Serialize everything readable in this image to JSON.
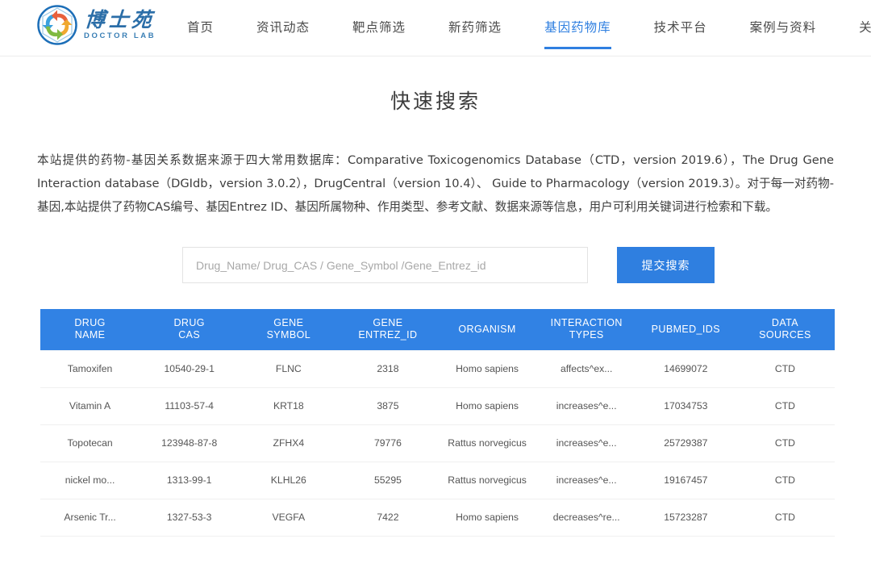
{
  "brand": {
    "logo_icon": "pinwheel-circle-logo",
    "name_cn": "博士苑",
    "name_en": "DOCTOR LAB"
  },
  "nav": {
    "items": [
      {
        "label": "首页",
        "active": false
      },
      {
        "label": "资讯动态",
        "active": false
      },
      {
        "label": "靶点筛选",
        "active": false
      },
      {
        "label": "新药筛选",
        "active": false
      },
      {
        "label": "基因药物库",
        "active": true
      },
      {
        "label": "技术平台",
        "active": false
      },
      {
        "label": "案例与资料",
        "active": false
      },
      {
        "label": "关于我们",
        "active": false
      }
    ]
  },
  "page": {
    "title": "快速搜索",
    "description": "本站提供的药物-基因关系数据来源于四大常用数据库：Comparative Toxicogenomics Database（CTD，version 2019.6），The Drug Gene Interaction database（DGIdb，version 3.0.2），DrugCentral（version 10.4）、 Guide to Pharmacology（version 2019.3）。对于每一对药物-基因,本站提供了药物CAS编号、基因Entrez ID、基因所属物种、作用类型、参考文献、数据来源等信息，用户可利用关键词进行检索和下载。"
  },
  "search": {
    "placeholder": "Drug_Name/ Drug_CAS / Gene_Symbol /Gene_Entrez_id",
    "value": "",
    "submit_label": "提交搜索"
  },
  "table": {
    "columns": [
      {
        "line1": "DRUG",
        "line2": "NAME"
      },
      {
        "line1": "DRUG",
        "line2": "CAS"
      },
      {
        "line1": "GENE",
        "line2": "SYMBOL"
      },
      {
        "line1": "GENE",
        "line2": "ENTREZ_ID"
      },
      {
        "line1": "ORGANISM",
        "line2": ""
      },
      {
        "line1": "INTERACTION",
        "line2": "TYPES"
      },
      {
        "line1": "PUBMED_IDS",
        "line2": ""
      },
      {
        "line1": "DATA",
        "line2": "SOURCES"
      }
    ],
    "rows": [
      {
        "drug_name": "Tamoxifen",
        "drug_cas": "10540-29-1",
        "gene_symbol": "FLNC",
        "gene_entrez_id": "2318",
        "organism": "Homo sapiens",
        "interaction_types": "affects^ex...",
        "pubmed_ids": "14699072",
        "data_sources": "CTD"
      },
      {
        "drug_name": "Vitamin A",
        "drug_cas": "11103-57-4",
        "gene_symbol": "KRT18",
        "gene_entrez_id": "3875",
        "organism": "Homo sapiens",
        "interaction_types": "increases^e...",
        "pubmed_ids": "17034753",
        "data_sources": "CTD"
      },
      {
        "drug_name": "Topotecan",
        "drug_cas": "123948-87-8",
        "gene_symbol": "ZFHX4",
        "gene_entrez_id": "79776",
        "organism": "Rattus norvegicus",
        "interaction_types": "increases^e...",
        "pubmed_ids": "25729387",
        "data_sources": "CTD"
      },
      {
        "drug_name": "nickel mo...",
        "drug_cas": "1313-99-1",
        "gene_symbol": "KLHL26",
        "gene_entrez_id": "55295",
        "organism": "Rattus norvegicus",
        "interaction_types": "increases^e...",
        "pubmed_ids": "19167457",
        "data_sources": "CTD"
      },
      {
        "drug_name": "Arsenic Tr...",
        "drug_cas": "1327-53-3",
        "gene_symbol": "VEGFA",
        "gene_entrez_id": "7422",
        "organism": "Homo sapiens",
        "interaction_types": "decreases^re...",
        "pubmed_ids": "15723287",
        "data_sources": "CTD"
      }
    ]
  },
  "colors": {
    "accent_blue": "#2f7fe0",
    "table_header_blue": "#3182e4",
    "brand_blue": "#2b6ea8",
    "text_dark": "#3d3d3d",
    "text_muted": "#555555"
  }
}
